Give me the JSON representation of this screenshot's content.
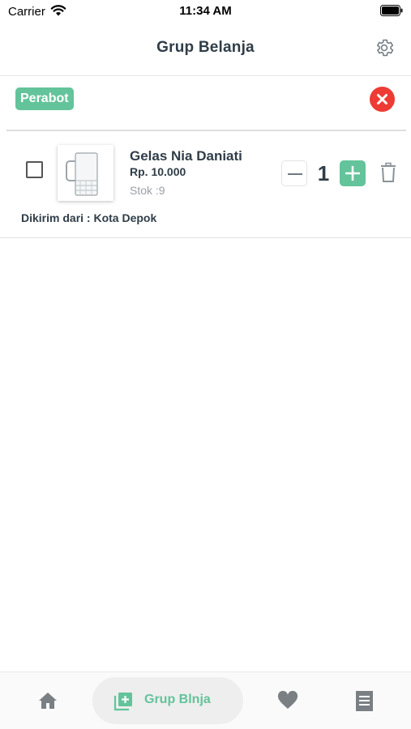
{
  "status_bar": {
    "carrier": "Carrier",
    "time": "11:34 AM"
  },
  "header": {
    "title": "Grup Belanja",
    "settings_icon": "gear-icon"
  },
  "group": {
    "tag": "Perabot",
    "close_icon": "close-circle-icon",
    "tag_color": "#63c39a",
    "close_color": "#ee3b33"
  },
  "cart_items": [
    {
      "name": "Gelas Nia Daniati",
      "price": "Rp. 10.000",
      "stock": "Stok :9",
      "quantity": "1",
      "shipping_label": "Dikirim dari : ",
      "shipping_city": "Kota Depok",
      "checked": false
    }
  ],
  "tabbar": {
    "active_label": "Grup Blnja",
    "icons": [
      "home-icon",
      "add-group-icon",
      "heart-icon",
      "list-icon"
    ],
    "accent": "#63c39a"
  }
}
